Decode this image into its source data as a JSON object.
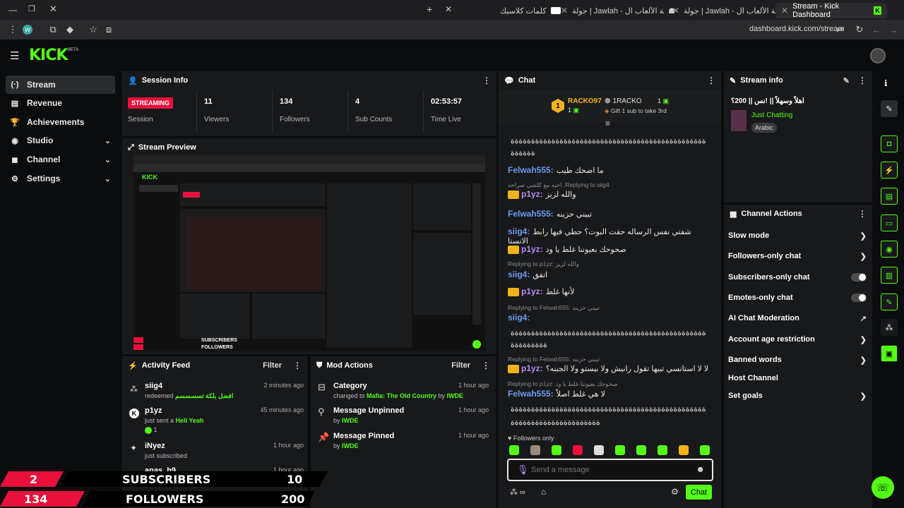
{
  "browser": {
    "tabs": [
      {
        "label": "Stream - Kick Dashboard",
        "active": true
      },
      {
        "label": "جولة | Jawlah - منصة الألعاب ال..."
      },
      {
        "label": "جولة | Jawlah - منصة الألعاب ال..."
      },
      {
        "label": "كلمات كلاسيك"
      }
    ],
    "url": "dashboard.kick.com/stream"
  },
  "app": {
    "logo": "KICK",
    "beta": "BETA"
  },
  "sidebar": {
    "items": [
      {
        "label": "Stream",
        "icon": "(·)"
      },
      {
        "label": "Revenue",
        "icon": "▤"
      },
      {
        "label": "Achievements",
        "icon": "🏆"
      },
      {
        "label": "Studio",
        "icon": "◉"
      },
      {
        "label": "Channel",
        "icon": "◼"
      },
      {
        "label": "Settings",
        "icon": "⚙"
      }
    ]
  },
  "session": {
    "title": "Session Info",
    "status": "STREAMING",
    "status_label": "Session",
    "stats": [
      {
        "value": "11",
        "label": "Viewers"
      },
      {
        "value": "134",
        "label": "Followers"
      },
      {
        "value": "4",
        "label": "Sub Counts"
      },
      {
        "value": "02:53:57",
        "label": "Time Live"
      }
    ]
  },
  "preview": {
    "title": "Stream Preview",
    "overlay_subs_left": "2",
    "overlay_subs_label": "SUBSCRIBERS",
    "overlay_subs_right": "10",
    "overlay_followers_left": "134",
    "overlay_followers_label": "FOLLOWERS",
    "overlay_followers_right": "200"
  },
  "activity": {
    "title": "Activity Feed",
    "filter": "Filter",
    "items": [
      {
        "name": "siig4",
        "pre": "redeemed ",
        "highlight": "افضل بلكة تسسسسم",
        "time": "2 minutes ago"
      },
      {
        "name": "p1yz",
        "pre": "just sent a ",
        "highlight": "Hell Yeah",
        "count": "1",
        "time": "45 minutes ago"
      },
      {
        "name": "iNyez",
        "pre": "just subscribed",
        "highlight": "",
        "time": "1 hour ago"
      },
      {
        "name": "anas_h9",
        "pre": "",
        "highlight": "",
        "time": "1 hour ago"
      }
    ]
  },
  "mod": {
    "title": "Mod Actions",
    "filter": "Filter",
    "items": [
      {
        "name": "Category",
        "pre": "changed to ",
        "highlight": "Mafia: The Old Country",
        "by": " by ",
        "user": "IWDE",
        "time": "1 hour ago"
      },
      {
        "name": "Message Unpinned",
        "pre": "",
        "highlight": "",
        "by": "by ",
        "user": "IWDE",
        "time": "1 hour ago"
      },
      {
        "name": "Message Pinned",
        "pre": "",
        "highlight": "",
        "by": "by ",
        "user": "IWDE",
        "time": "1 hour ago"
      }
    ]
  },
  "chat": {
    "title": "Chat",
    "gifter1": {
      "rank": "1",
      "name": "RACKO97",
      "count": "1"
    },
    "gifter2": {
      "name": "1RACKO",
      "count": "1",
      "note": "Gift 1 sub to take 3rd"
    },
    "messages": [
      {
        "user": "",
        "text": "ةةةةةةةةةةةةةةةةةةةةةةةةةةةةةةةةةةةةةةةةةةةةةةةة"
      },
      {
        "user": "",
        "text": "ةةةةةة"
      },
      {
        "user": "Felwah555",
        "color": "blue",
        "text": "ما اضحك طيب"
      },
      {
        "reply": "احبه مع كلشي صراحه :Replying to siig4"
      },
      {
        "user": "p1yz",
        "color": "purple",
        "crown": true,
        "text": "والله لزيز"
      },
      {
        "user": "Felwah555",
        "color": "blue",
        "text": "تبيني حزينه"
      },
      {
        "user": "siig4",
        "color": "blue",
        "text": "شفتي نفس الرساله حقت البوت؟ حطي فيها رابط الانستا"
      },
      {
        "user": "p1yz",
        "color": "purple",
        "crown": true,
        "text": "صحوحك بعيوننا غلط يا ود"
      },
      {
        "reply": "Replying to p1yz: والله لزيز"
      },
      {
        "user": "siig4",
        "color": "blue",
        "text": "اتفق"
      },
      {
        "user": "p1yz",
        "color": "purple",
        "crown": true,
        "text": "لأنها غلط"
      },
      {
        "reply": "Replying to Felwah555: تبيني حزينه"
      },
      {
        "user": "siig4",
        "color": "blue",
        "text": ""
      },
      {
        "user": "",
        "text": "ةةةةةةةةةةةةةةةةةةةةةةةةةةةةةةةةةةةةةةةةةةةةةةةة"
      },
      {
        "user": "",
        "text": "ةةةةةةةةة"
      },
      {
        "reply": "Replying to Felwah555: تبيني حزينه"
      },
      {
        "user": "p1yz",
        "color": "purple",
        "crown": true,
        "text": "لا لا استانسي تبيها تقول رانيش ولا بيستو ولا الجبنه؟"
      },
      {
        "reply": "Replying to p1yz: صحوحك بعيوننا غلط يا ود"
      },
      {
        "user": "Felwah555",
        "color": "blue",
        "text": "لا هي غلط اصلاً"
      },
      {
        "user": "",
        "text": "ةةةةةةةةةةةةةةةةةةةةةةةةةةةةةةةةةةةةةةةةةةةةةةةة"
      },
      {
        "user": "",
        "text": "ةةةةةةةةةةةةةةةةةةةةةة"
      }
    ],
    "followers_only": "Followers only",
    "placeholder": "Send a message",
    "send": "Chat"
  },
  "streaminfo": {
    "title": "Stream info",
    "stream_title": "اهلاً وسهلاً || !نس || 200؟",
    "category": "Just Chatting",
    "tag": "Arabic"
  },
  "actions": {
    "title": "Channel Actions",
    "items": [
      {
        "label": "Slow mode",
        "kind": "chev"
      },
      {
        "label": "Followers-only chat",
        "kind": "chev"
      },
      {
        "label": "Subscribers-only chat",
        "kind": "toggle"
      },
      {
        "label": "Emotes-only chat",
        "kind": "toggle"
      },
      {
        "label": "AI Chat Moderation",
        "kind": "ext"
      },
      {
        "label": "Account age restriction",
        "kind": "chev"
      },
      {
        "label": "Banned words",
        "kind": "chev"
      },
      {
        "label": "Host Channel",
        "kind": "none"
      },
      {
        "label": "Set goals",
        "kind": "chev"
      }
    ]
  },
  "colors": {
    "accent": "#53fc18",
    "streaming": "#e9113c"
  }
}
